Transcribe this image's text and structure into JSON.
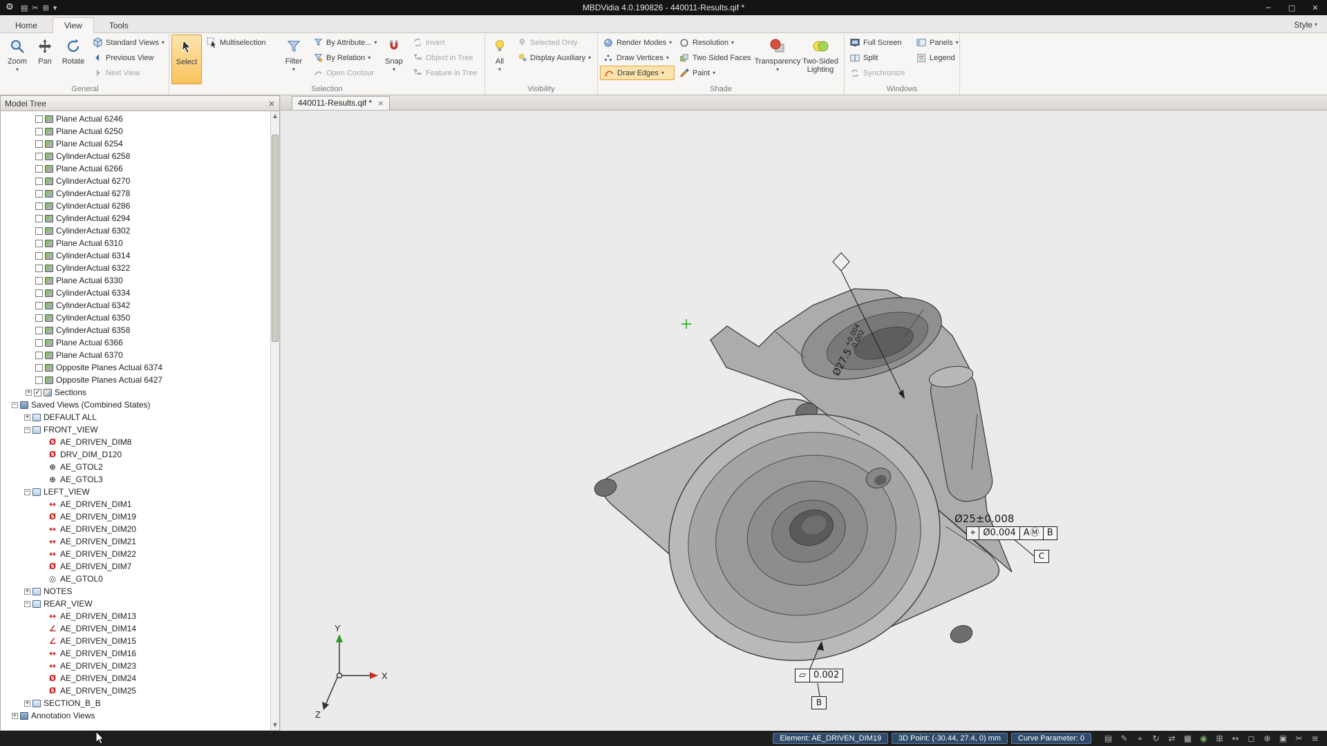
{
  "titlebar": {
    "title": "MBDVidia 4.0.190826 - 440011-Results.qif *",
    "minimize": "─",
    "maximize": "□",
    "close": "✕"
  },
  "menu": {
    "style_label": "Style"
  },
  "tabs": [
    {
      "label": "Home"
    },
    {
      "label": "View"
    },
    {
      "label": "Tools"
    }
  ],
  "ribbon": {
    "general": {
      "label": "General",
      "zoom": "Zoom",
      "pan": "Pan",
      "rotate": "Rotate",
      "standard_views": "Standard Views",
      "previous_view": "Previous View",
      "next_view": "Next View"
    },
    "selection": {
      "label": "Selection",
      "select": "Select",
      "multiselection": "Multiselection",
      "filter": "Filter",
      "by_attribute": "By Attribute...",
      "by_relation": "By Relation",
      "open_contour": "Open Contour",
      "snap": "Snap",
      "invert": "Invert",
      "object_in_tree": "Object in Tree",
      "feature_in_tree": "Feature in Tree"
    },
    "visibility": {
      "label": "Visibility",
      "all": "All",
      "selected_only": "Selected Only",
      "display_auxiliary": "Display Auxiliary"
    },
    "shade": {
      "label": "Shade",
      "render_modes": "Render Modes",
      "draw_vertices": "Draw Vertices",
      "draw_edges": "Draw Edges",
      "resolution": "Resolution",
      "two_sided_faces": "Two Sided Faces",
      "paint": "Paint",
      "transparency": "Transparency",
      "two_sided_lighting": "Two-Sided Lighting"
    },
    "windows": {
      "label": "Windows",
      "full_screen": "Full Screen",
      "split": "Split",
      "synchronize": "Synchronize",
      "panels": "Panels",
      "legend": "Legend"
    }
  },
  "document_tab": {
    "label": "440011-Results.qif *",
    "close": "×"
  },
  "model_tree": {
    "title": "Model Tree",
    "close": "×",
    "icon_glyphs": {
      "dia": {
        "glyph": "Ø",
        "color": "#c42222"
      },
      "lin": {
        "glyph": "↔",
        "color": "#c42222"
      },
      "ang": {
        "glyph": "∠",
        "color": "#c42222"
      },
      "gtol": {
        "glyph": "⊕",
        "color": "#444444"
      },
      "circ": {
        "glyph": "◎",
        "color": "#444444"
      }
    },
    "items": [
      {
        "label": "Plane Actual 6246",
        "indent": 50,
        "cb": 0,
        "icon": "feature"
      },
      {
        "label": "Plane Actual 6250",
        "indent": 50,
        "cb": 0,
        "icon": "feature"
      },
      {
        "label": "Plane Actual 6254",
        "indent": 50,
        "cb": 0,
        "icon": "feature"
      },
      {
        "label": "CylinderActual 6258",
        "indent": 50,
        "cb": 0,
        "icon": "feature"
      },
      {
        "label": "Plane Actual 6266",
        "indent": 50,
        "cb": 0,
        "icon": "feature"
      },
      {
        "label": "CylinderActual 6270",
        "indent": 50,
        "cb": 0,
        "icon": "feature"
      },
      {
        "label": "CylinderActual 6278",
        "indent": 50,
        "cb": 0,
        "icon": "feature"
      },
      {
        "label": "CylinderActual 6286",
        "indent": 50,
        "cb": 0,
        "icon": "feature"
      },
      {
        "label": "CylinderActual 6294",
        "indent": 50,
        "cb": 0,
        "icon": "feature"
      },
      {
        "label": "CylinderActual 6302",
        "indent": 50,
        "cb": 0,
        "icon": "feature"
      },
      {
        "label": "Plane Actual 6310",
        "indent": 50,
        "cb": 0,
        "icon": "feature"
      },
      {
        "label": "CylinderActual 6314",
        "indent": 50,
        "cb": 0,
        "icon": "feature"
      },
      {
        "label": "CylinderActual 6322",
        "indent": 50,
        "cb": 0,
        "icon": "feature"
      },
      {
        "label": "Plane Actual 6330",
        "indent": 50,
        "cb": 0,
        "icon": "feature"
      },
      {
        "label": "CylinderActual 6334",
        "indent": 50,
        "cb": 0,
        "icon": "feature"
      },
      {
        "label": "CylinderActual 6342",
        "indent": 50,
        "cb": 0,
        "icon": "feature"
      },
      {
        "label": "CylinderActual 6350",
        "indent": 50,
        "cb": 0,
        "icon": "feature"
      },
      {
        "label": "CylinderActual 6358",
        "indent": 50,
        "cb": 0,
        "icon": "feature"
      },
      {
        "label": "Plane Actual 6366",
        "indent": 50,
        "cb": 0,
        "icon": "feature"
      },
      {
        "label": "Plane Actual 6370",
        "indent": 50,
        "cb": 0,
        "icon": "feature"
      },
      {
        "label": "Opposite Planes Actual 6374",
        "indent": 50,
        "cb": 0,
        "icon": "feature"
      },
      {
        "label": "Opposite Planes Actual 6427",
        "indent": 50,
        "cb": 0,
        "icon": "feature"
      },
      {
        "label": "Sections",
        "indent": 36,
        "exp": "+",
        "cb": 1,
        "icon": "section"
      },
      {
        "label": "Saved Views (Combined States)",
        "indent": 16,
        "exp": "-",
        "icon": "views"
      },
      {
        "label": "DEFAULT ALL",
        "indent": 34,
        "exp": "+",
        "icon": "view"
      },
      {
        "label": "FRONT_VIEW",
        "indent": 34,
        "exp": "-",
        "icon": "view"
      },
      {
        "label": "AE_DRIVEN_DIM8",
        "indent": 68,
        "icon": "dia"
      },
      {
        "label": "DRV_DIM_D120",
        "indent": 68,
        "icon": "dia"
      },
      {
        "label": "AE_GTOL2",
        "indent": 68,
        "icon": "gtol"
      },
      {
        "label": "AE_GTOL3",
        "indent": 68,
        "icon": "gtol"
      },
      {
        "label": "LEFT_VIEW",
        "indent": 34,
        "exp": "-",
        "icon": "view"
      },
      {
        "label": "AE_DRIVEN_DIM1",
        "indent": 68,
        "icon": "lin"
      },
      {
        "label": "AE_DRIVEN_DIM19",
        "indent": 68,
        "icon": "dia"
      },
      {
        "label": "AE_DRIVEN_DIM20",
        "indent": 68,
        "icon": "lin"
      },
      {
        "label": "AE_DRIVEN_DIM21",
        "indent": 68,
        "icon": "lin"
      },
      {
        "label": "AE_DRIVEN_DIM22",
        "indent": 68,
        "icon": "lin"
      },
      {
        "label": "AE_DRIVEN_DIM7",
        "indent": 68,
        "icon": "dia"
      },
      {
        "label": "AE_GTOL0",
        "indent": 68,
        "icon": "circ"
      },
      {
        "label": "NOTES",
        "indent": 34,
        "exp": "+",
        "icon": "view"
      },
      {
        "label": "REAR_VIEW",
        "indent": 34,
        "exp": "-",
        "icon": "view"
      },
      {
        "label": "AE_DRIVEN_DIM13",
        "indent": 68,
        "icon": "lin"
      },
      {
        "label": "AE_DRIVEN_DIM14",
        "indent": 68,
        "icon": "ang"
      },
      {
        "label": "AE_DRIVEN_DIM15",
        "indent": 68,
        "icon": "ang"
      },
      {
        "label": "AE_DRIVEN_DIM16",
        "indent": 68,
        "icon": "lin"
      },
      {
        "label": "AE_DRIVEN_DIM23",
        "indent": 68,
        "icon": "lin"
      },
      {
        "label": "AE_DRIVEN_DIM24",
        "indent": 68,
        "icon": "dia"
      },
      {
        "label": "AE_DRIVEN_DIM25",
        "indent": 68,
        "icon": "dia"
      },
      {
        "label": "SECTION_B_B",
        "indent": 34,
        "exp": "+",
        "icon": "view"
      },
      {
        "label": "Annotation Views",
        "indent": 16,
        "exp": "+",
        "icon": "views"
      }
    ]
  },
  "viewport": {
    "dim_prefix": "Ø27.5",
    "dim_upper": "+0.004",
    "dim_lower": "-0.002",
    "dia_label": "Ø25±0.008",
    "fcf_position": {
      "symbol": "⌖",
      "tolerance": "Ø0.004",
      "datum1": "A",
      "modifier": "Ⓜ",
      "datum2": "B"
    },
    "datum_c": "C",
    "fcf_flatness": {
      "symbol": "▱",
      "tolerance": "0.002"
    },
    "datum_b": "B",
    "triad": {
      "x": "X",
      "y": "Y",
      "z": "Z"
    }
  },
  "statusbar": {
    "element": "Element: AE_DRIVEN_DIM19",
    "point": "3D Point: (-30.44, 27.4, 0) mm",
    "curve": "Curve Parameter: 0",
    "icons": [
      {
        "name": "annotation-icon",
        "glyph": "▤"
      },
      {
        "name": "edit-icon",
        "glyph": "✎"
      },
      {
        "name": "target-icon",
        "glyph": "⌖"
      },
      {
        "name": "rotate-view-icon",
        "glyph": "↻"
      },
      {
        "name": "swap-icon",
        "glyph": "⇄"
      },
      {
        "name": "grid-icon",
        "glyph": "▦"
      },
      {
        "name": "record-icon",
        "glyph": "◉",
        "color": "#7fb069"
      },
      {
        "name": "layers-icon",
        "glyph": "⊞"
      },
      {
        "name": "measure-icon",
        "glyph": "↔"
      },
      {
        "name": "frame-icon",
        "glyph": "◻"
      },
      {
        "name": "position-icon",
        "glyph": "⊕"
      },
      {
        "name": "panel-icon",
        "glyph": "▣"
      },
      {
        "name": "scissors-icon",
        "glyph": "✂"
      },
      {
        "name": "menu-icon",
        "glyph": "≡"
      }
    ]
  },
  "colors": {
    "accent_orange": "#f2b13d",
    "dim_red": "#c42222",
    "status_segment_blue": "#2e4a68",
    "viewport_background": "#ebebeb"
  }
}
